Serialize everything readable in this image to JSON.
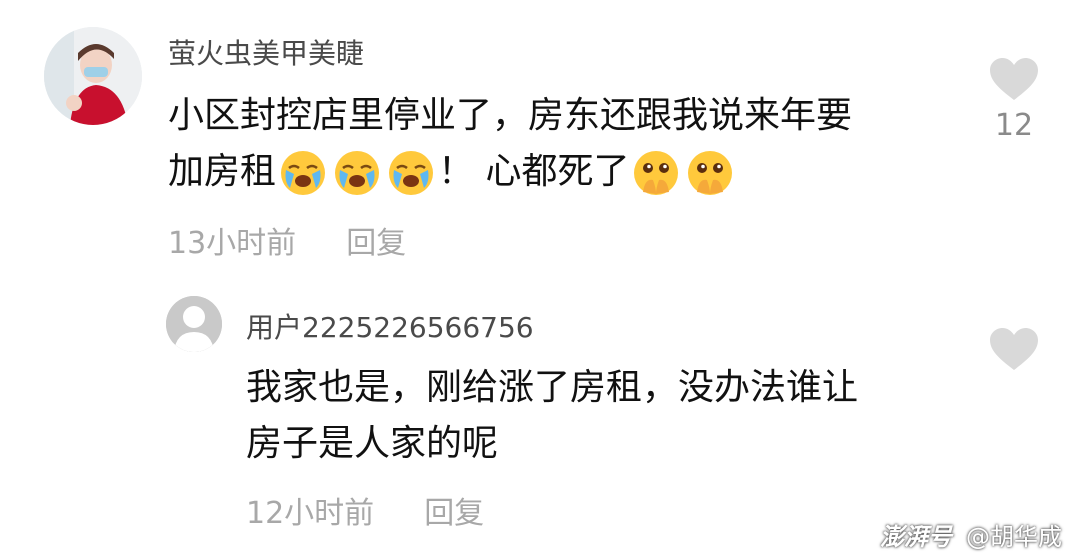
{
  "comment": {
    "username": "萤火虫美甲美睫",
    "text_line1": "小区封控店里停业了，房东还跟我说来年要",
    "text_line2_start": "加房租",
    "text_line2_end": "！ 心都死了",
    "time": "13小时前",
    "reply_label": "回复",
    "like_count": "12"
  },
  "reply": {
    "username": "用户2225226566756",
    "text_line1": "我家也是，刚给涨了房租，没办法谁让",
    "text_line2": "房子是人家的呢",
    "time": "12小时前",
    "reply_label": "回复"
  },
  "watermark": {
    "logo": "澎湃号",
    "author": "@胡华成"
  },
  "icons": {
    "like": "heart-icon",
    "crying_emoji": "crying-face-icon",
    "shy_emoji": "covering-mouth-face-icon"
  },
  "colors": {
    "username": "#4a4a4a",
    "text": "#111111",
    "meta": "#a8a8a8",
    "heart": "#d9d9d9"
  }
}
